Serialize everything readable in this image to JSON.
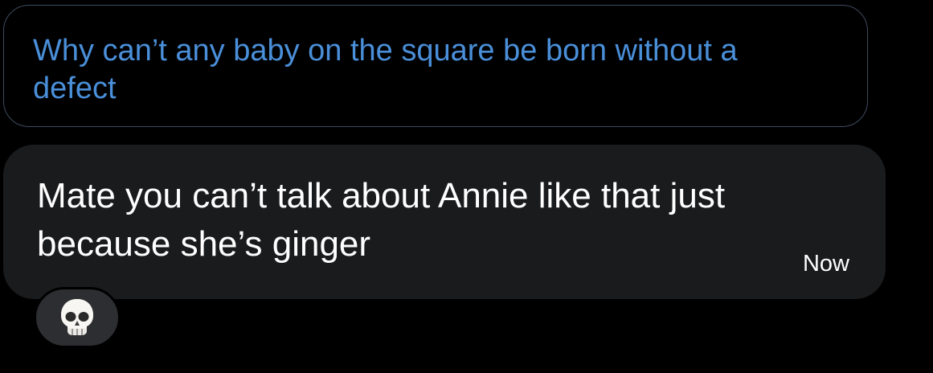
{
  "quoted_message": {
    "text": "Why can’t any baby on the square be born without a defect"
  },
  "message": {
    "text": "Mate you can’t talk about Annie like that just because she’s ginger",
    "timestamp": "Now"
  },
  "reaction": {
    "icon": "skull-icon"
  },
  "colors": {
    "background": "#000000",
    "quoted_text": "#4a8fd9",
    "quoted_border": "#3d4b5e",
    "bubble": "#1a1b1d",
    "reaction_pill": "#2d2e31",
    "text": "#ffffff"
  }
}
